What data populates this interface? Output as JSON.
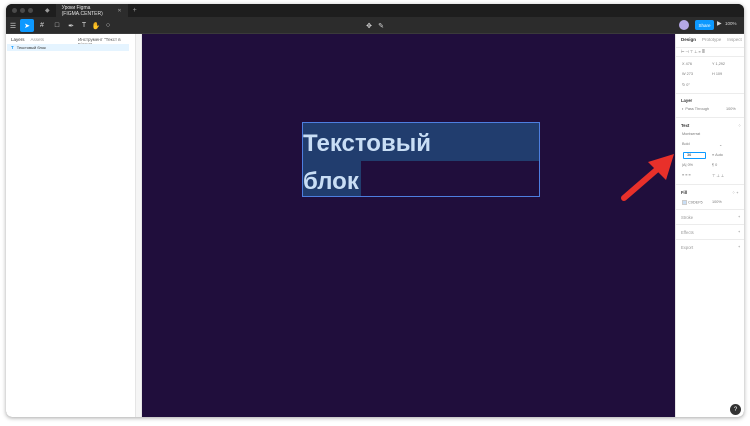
{
  "tab": {
    "title": "Уроки Figma (FIGMA.CENTER)"
  },
  "toolbar": {
    "share_label": "Share",
    "zoom": "100%"
  },
  "layers_panel": {
    "tab_layers": "Layers",
    "tab_assets": "Assets",
    "page_label": "Инструмент \"Текст в Figma\"",
    "layer_name": "Текстовый блок"
  },
  "canvas": {
    "background": "#200e3c",
    "text_line1": "Текстовый",
    "text_line2": "блок"
  },
  "design_panel": {
    "tabs": [
      "Design",
      "Prototype",
      "Inspect"
    ],
    "x": "476",
    "y": "1,292",
    "w": "273",
    "h": "109",
    "rotation": "0°",
    "layer_title": "Layer",
    "pass_through": "Pass Through",
    "layer_opacity": "100%",
    "text_title": "Text",
    "font_family": "Montserrat",
    "font_style": "Bold",
    "font_size": "36",
    "line_height": "Auto",
    "letter_spacing": "0%",
    "paragraph_spacing": "0",
    "fill_title": "Fill",
    "fill_hex": "C9DEF5",
    "fill_opacity": "100%",
    "stroke_title": "Stroke",
    "effects_title": "Effects",
    "export_title": "Export"
  },
  "colors": {
    "accent": "#0d99ff",
    "canvas": "#200e3c",
    "text_fill": "#c9def5",
    "highlight": "#213d6e",
    "arrow": "#e8302a"
  }
}
